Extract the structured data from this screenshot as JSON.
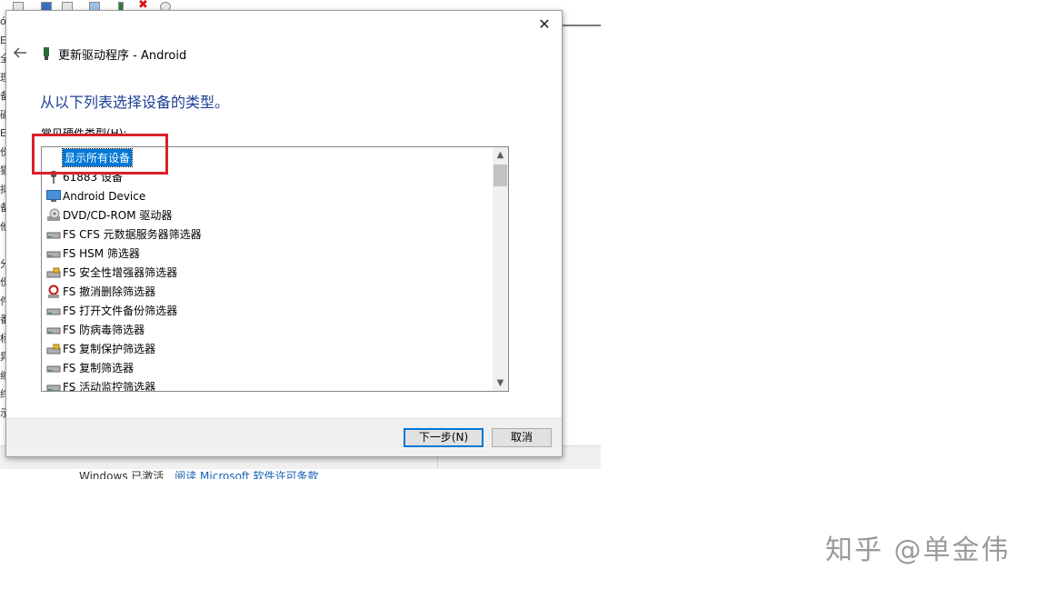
{
  "background": {
    "left_chars": [
      "ó",
      "E",
      "全",
      "理",
      "备",
      "磁",
      "E",
      "份",
      "猫",
      "拟",
      "备",
      "他",
      "",
      "分",
      "份",
      "件",
      "番",
      "杨",
      "异",
      "缩",
      "终",
      "示"
    ],
    "footer_activation": "Windows 已激活",
    "footer_link": "阅读 Microsoft 软件许可条款"
  },
  "dialog": {
    "title": "更新驱动程序 - Android",
    "close_glyph": "✕",
    "heading": "从以下列表选择设备的类型。",
    "list_label": "常见硬件类型(H):",
    "items": [
      {
        "label": "显示所有设备",
        "icon": "none"
      },
      {
        "label": "61883 设备",
        "icon": "plug-icon"
      },
      {
        "label": "Android Device",
        "icon": "monitor-icon"
      },
      {
        "label": "DVD/CD-ROM 驱动器",
        "icon": "cdrom-icon"
      },
      {
        "label": "FS CFS 元数据服务器筛选器",
        "icon": "drive-icon"
      },
      {
        "label": "FS HSM 筛选器",
        "icon": "drive-icon"
      },
      {
        "label": "FS 安全性增强器筛选器",
        "icon": "lock-drive-icon"
      },
      {
        "label": "FS 撤消删除筛选器",
        "icon": "undelete-icon"
      },
      {
        "label": "FS 打开文件备份筛选器",
        "icon": "drive-icon"
      },
      {
        "label": "FS 防病毒筛选器",
        "icon": "drive-icon"
      },
      {
        "label": "FS 复制保护筛选器",
        "icon": "lock-drive-icon"
      },
      {
        "label": "FS 复制筛选器",
        "icon": "drive-icon"
      },
      {
        "label": "FS 活动监控筛选器",
        "icon": "drive-icon"
      }
    ],
    "buttons": {
      "next": "下一步(N)",
      "cancel": "取消"
    }
  },
  "watermark": "知乎 @单金伟",
  "colors": {
    "heading": "#1d3f98",
    "selection": "#0078d7",
    "highlight_box": "#d9212b"
  }
}
